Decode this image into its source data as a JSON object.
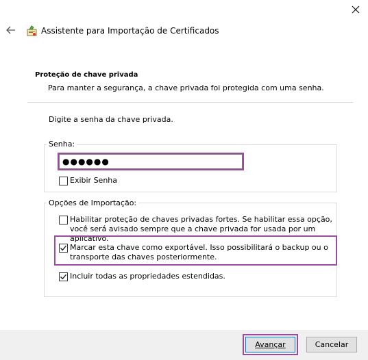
{
  "window": {
    "title": "Assistente para Importação de Certificados"
  },
  "header": {
    "section_title": "Proteção de chave privada",
    "section_desc": "Para manter a segurança, a chave privada foi protegida com uma senha."
  },
  "main": {
    "prompt": "Digite a senha da chave privada.",
    "password_group": {
      "legend": "Senha:",
      "password_value": "●●●●●●",
      "show_password": {
        "label": "Exibir Senha",
        "checked": false
      }
    },
    "options_group": {
      "legend": "Opções de Importação:",
      "options": [
        {
          "label": "Habilitar proteção de chaves privadas fortes. Se habilitar essa opção, você será avisado sempre que a chave privada for usada por um aplicativo.",
          "checked": false
        },
        {
          "label": "Marcar esta chave como exportável. Isso possibilitará o backup ou o transporte das chaves posteriormente.",
          "checked": true
        },
        {
          "label": "Incluir todas as propriedades estendidas.",
          "checked": true
        }
      ]
    }
  },
  "footer": {
    "next_label": "Avançar",
    "cancel_label": "Cancelar"
  },
  "colors": {
    "highlight": "#9b4a9e",
    "accent": "#0078d7"
  }
}
